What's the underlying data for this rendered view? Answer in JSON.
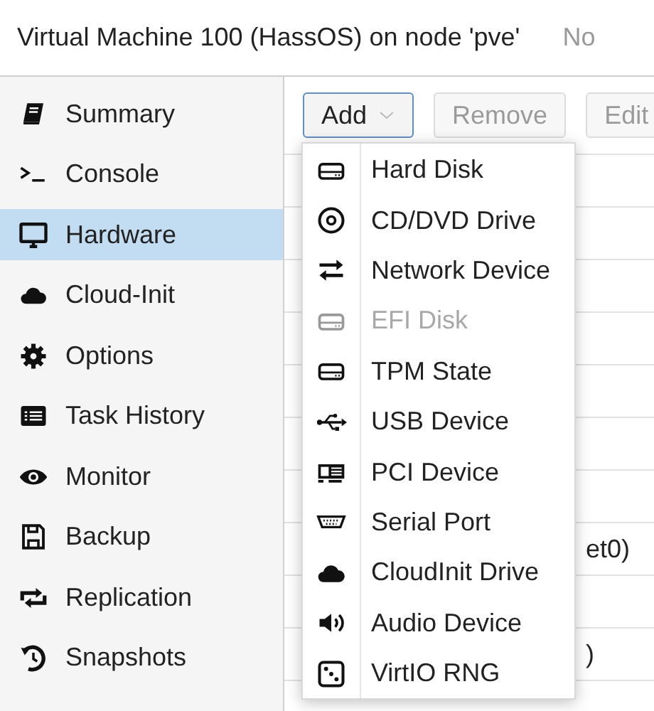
{
  "window": {
    "title": "Virtual Machine 100 (HassOS) on node 'pve'",
    "title_right": "No"
  },
  "sidebar": {
    "items": [
      {
        "label": "Summary",
        "selected": false
      },
      {
        "label": "Console",
        "selected": false
      },
      {
        "label": "Hardware",
        "selected": true
      },
      {
        "label": "Cloud-Init",
        "selected": false
      },
      {
        "label": "Options",
        "selected": false
      },
      {
        "label": "Task History",
        "selected": false
      },
      {
        "label": "Monitor",
        "selected": false
      },
      {
        "label": "Backup",
        "selected": false
      },
      {
        "label": "Replication",
        "selected": false
      },
      {
        "label": "Snapshots",
        "selected": false
      }
    ]
  },
  "toolbar": {
    "buttons": [
      {
        "label": "Add",
        "kind": "dropdown",
        "disabled": false
      },
      {
        "label": "Remove",
        "kind": "plain",
        "disabled": true
      },
      {
        "label": "Edit",
        "kind": "plain",
        "disabled": true
      }
    ]
  },
  "grid": {
    "cells": [
      "et0)",
      ")"
    ]
  },
  "add_menu": {
    "items": [
      {
        "label": "Hard Disk",
        "disabled": false
      },
      {
        "label": "CD/DVD Drive",
        "disabled": false
      },
      {
        "label": "Network Device",
        "disabled": false
      },
      {
        "label": "EFI Disk",
        "disabled": true
      },
      {
        "label": "TPM State",
        "disabled": false
      },
      {
        "label": "USB Device",
        "disabled": false
      },
      {
        "label": "PCI Device",
        "disabled": false
      },
      {
        "label": "Serial Port",
        "disabled": false
      },
      {
        "label": "CloudInit Drive",
        "disabled": false
      },
      {
        "label": "Audio Device",
        "disabled": false
      },
      {
        "label": "VirtIO RNG",
        "disabled": false
      }
    ]
  }
}
